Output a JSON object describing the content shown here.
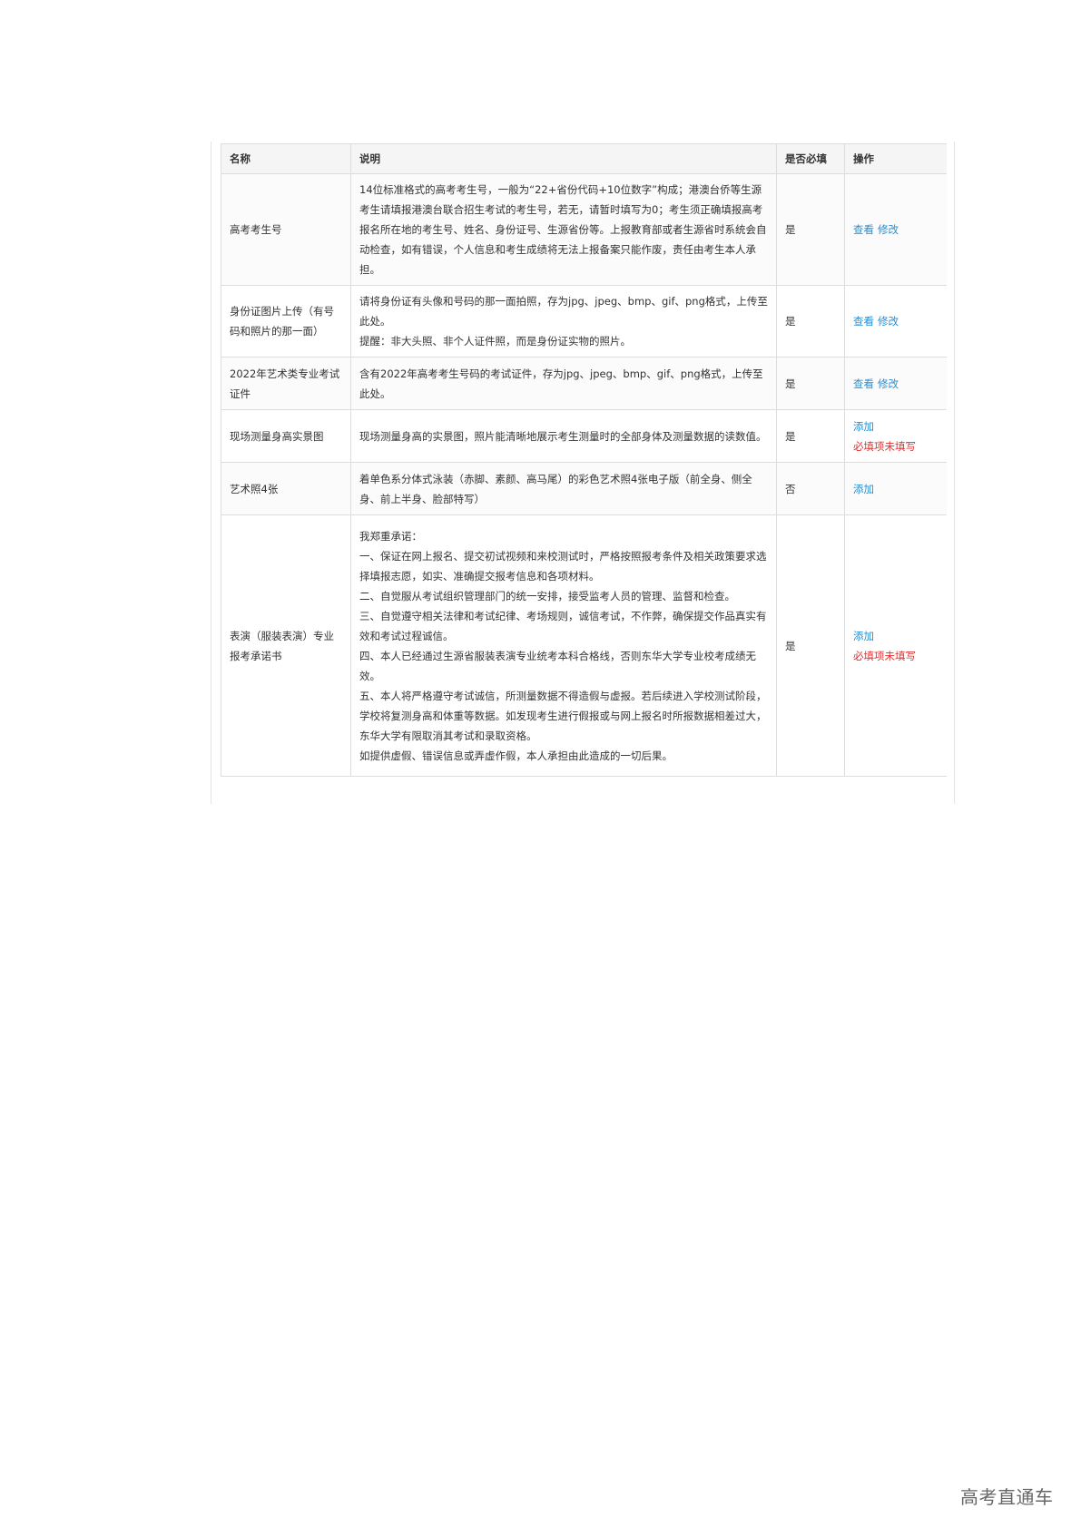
{
  "table": {
    "headers": {
      "name": "名称",
      "description": "说明",
      "required": "是否必填",
      "actions": "操作"
    },
    "rows": [
      {
        "name": "高考考生号",
        "description_lines": [
          "14位标准格式的高考考生号，一般为“22+省份代码+10位数字”构成；港澳台侨等生源考生请填报港澳台联合招生考试的考生号，若无，请暂时填写为0；考生须正确填报高考报名所在地的考生号、姓名、身份证号、生源省份等。上报教育部或者生源省时系统会自动检查，如有错误，个人信息和考生成绩将无法上报备案只能作废，责任由考生本人承担。"
        ],
        "required": "是",
        "action_view": "查看",
        "action_edit": "修改"
      },
      {
        "name": "身份证图片上传（有号码和照片的那一面）",
        "description_lines": [
          "请将身份证有头像和号码的那一面拍照，存为jpg、jpeg、bmp、gif、png格式，上传至此处。",
          "提醒：非大头照、非个人证件照，而是身份证实物的照片。"
        ],
        "required": "是",
        "action_view": "查看",
        "action_edit": "修改"
      },
      {
        "name": "2022年艺术类专业考试证件",
        "description_lines": [
          "含有2022年高考考生号码的考试证件，存为jpg、jpeg、bmp、gif、png格式，上传至此处。"
        ],
        "required": "是",
        "action_view": "查看",
        "action_edit": "修改"
      },
      {
        "name": "现场测量身高实景图",
        "description_lines": [
          "现场测量身高的实景图，照片能清晰地展示考生测量时的全部身体及测量数据的读数值。"
        ],
        "required": "是",
        "action_add": "添加",
        "action_error": "必填项未填写"
      },
      {
        "name": "艺术照4张",
        "description_lines": [
          "着单色系分体式泳装（赤脚、素颜、高马尾）的彩色艺术照4张电子版（前全身、侧全身、前上半身、脸部特写）"
        ],
        "required": "否",
        "action_add": "添加"
      },
      {
        "name": "表演（服装表演）专业报考承诺书",
        "description_lines": [
          "我郑重承诺：",
          "一、保证在网上报名、提交初试视频和来校测试时，严格按照报考条件及相关政策要求选择填报志愿，如实、准确提交报考信息和各项材料。",
          "二、自觉服从考试组织管理部门的统一安排，接受监考人员的管理、监督和检查。",
          "三、自觉遵守相关法律和考试纪律、考场规则，诚信考试，不作弊，确保提交作品真实有效和考试过程诚信。",
          "四、本人已经通过生源省服装表演专业统考本科合格线，否则东华大学专业校考成绩无效。",
          "五、本人将严格遵守考试诚信，所测量数据不得造假与虚报。若后续进入学校测试阶段，学校将复测身高和体重等数据。如发现考生进行假报或与网上报名时所报数据相差过大，东华大学有限取消其考试和录取资格。",
          "如提供虚假、错误信息或弄虚作假，本人承担由此造成的一切后果。"
        ],
        "required": "是",
        "action_add": "添加",
        "action_error": "必填项未填写"
      }
    ]
  },
  "watermark": "高考直通车",
  "colors": {
    "link": "#2a8fd3",
    "error": "#e03030",
    "header_bg": "#f5f5f5",
    "border": "#dddddd"
  }
}
